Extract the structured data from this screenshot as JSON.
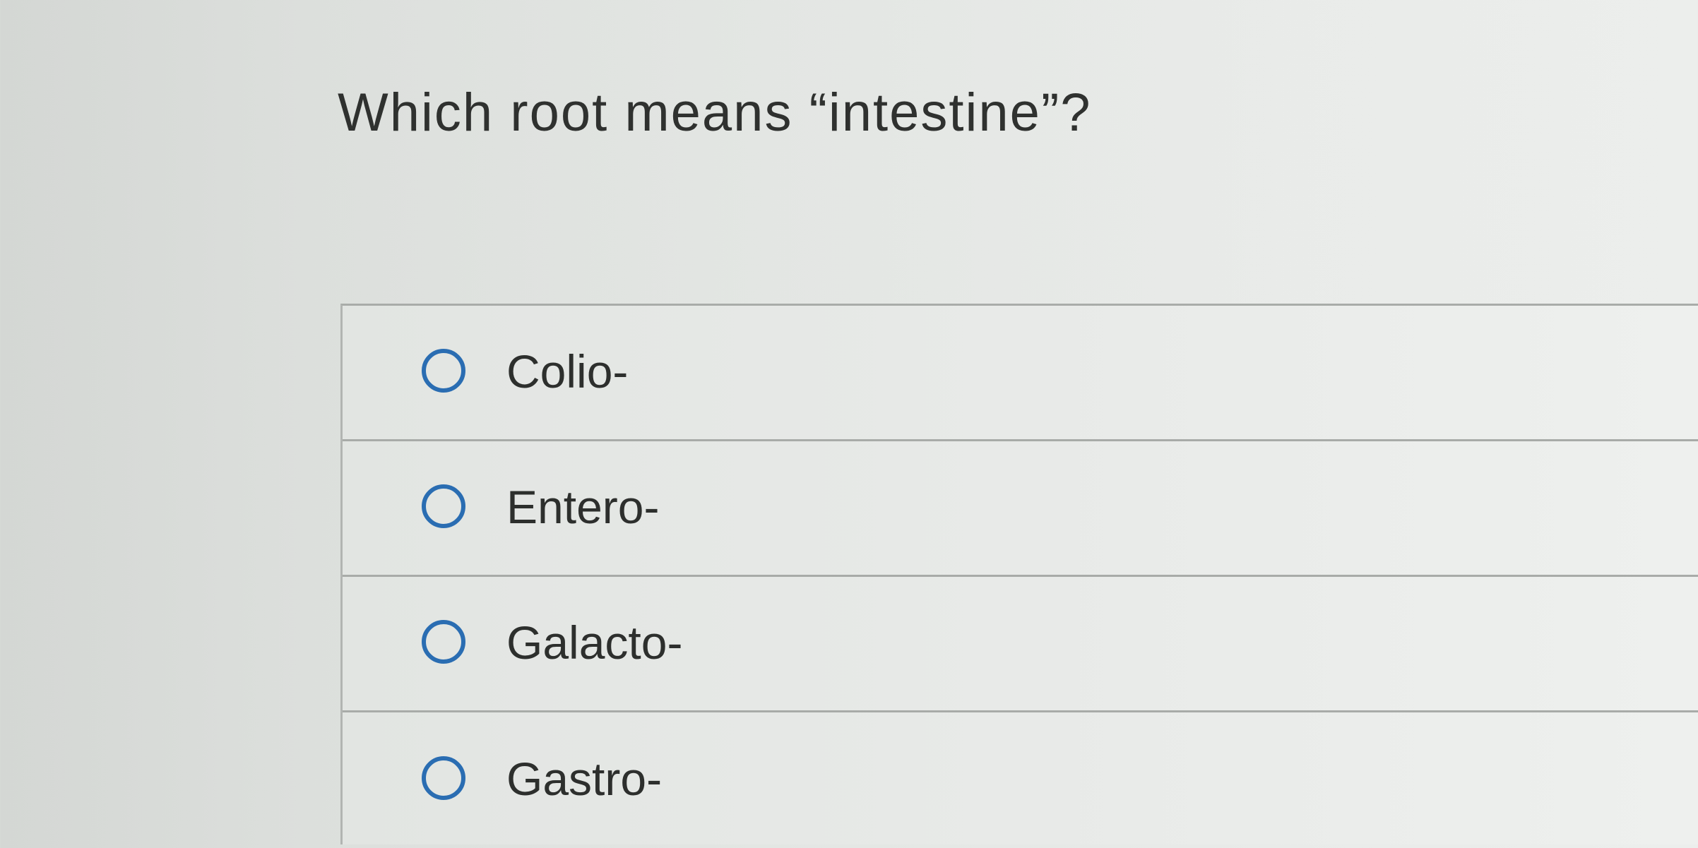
{
  "question": {
    "text": "Which root means “intestine”?"
  },
  "options": [
    {
      "label": "Colio-",
      "selected": false,
      "icon": "radio-unchecked-icon"
    },
    {
      "label": "Entero-",
      "selected": false,
      "icon": "radio-unchecked-icon"
    },
    {
      "label": "Galacto-",
      "selected": false,
      "icon": "radio-unchecked-icon"
    },
    {
      "label": "Gastro-",
      "selected": false,
      "icon": "radio-unchecked-icon"
    }
  ],
  "colors": {
    "radio_border": "#2a6db2",
    "text": "#2d2f2d",
    "divider": "#a8aba8"
  }
}
